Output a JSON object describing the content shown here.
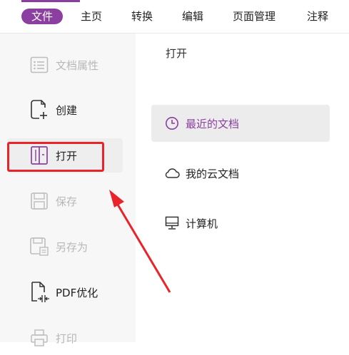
{
  "ribbon": {
    "tabs": [
      {
        "label": "文件",
        "active": true
      },
      {
        "label": "主页"
      },
      {
        "label": "转换"
      },
      {
        "label": "编辑"
      },
      {
        "label": "页面管理"
      },
      {
        "label": "注释"
      }
    ]
  },
  "sidebar": {
    "items": [
      {
        "label": "文档属性",
        "icon": "document-properties-icon",
        "enabled": false
      },
      {
        "label": "创建",
        "icon": "create-document-icon",
        "enabled": true
      },
      {
        "label": "打开",
        "icon": "open-book-icon",
        "enabled": true,
        "selected": true
      },
      {
        "label": "保存",
        "icon": "save-icon",
        "enabled": false
      },
      {
        "label": "另存为",
        "icon": "save-as-icon",
        "enabled": false
      },
      {
        "label": "PDF优化",
        "icon": "pdf-optimize-icon",
        "enabled": true
      },
      {
        "label": "打印",
        "icon": "print-icon",
        "enabled": false
      }
    ]
  },
  "open_panel": {
    "title": "打开",
    "items": [
      {
        "label": "最近的文档",
        "icon": "clock-icon",
        "selected": true
      },
      {
        "label": "我的云文档",
        "icon": "cloud-icon"
      },
      {
        "label": "计算机",
        "icon": "computer-icon"
      }
    ]
  },
  "colors": {
    "accent": "#8b3fa0",
    "annotation_red": "#e8242a",
    "disabled_text": "#b8b8b8"
  }
}
